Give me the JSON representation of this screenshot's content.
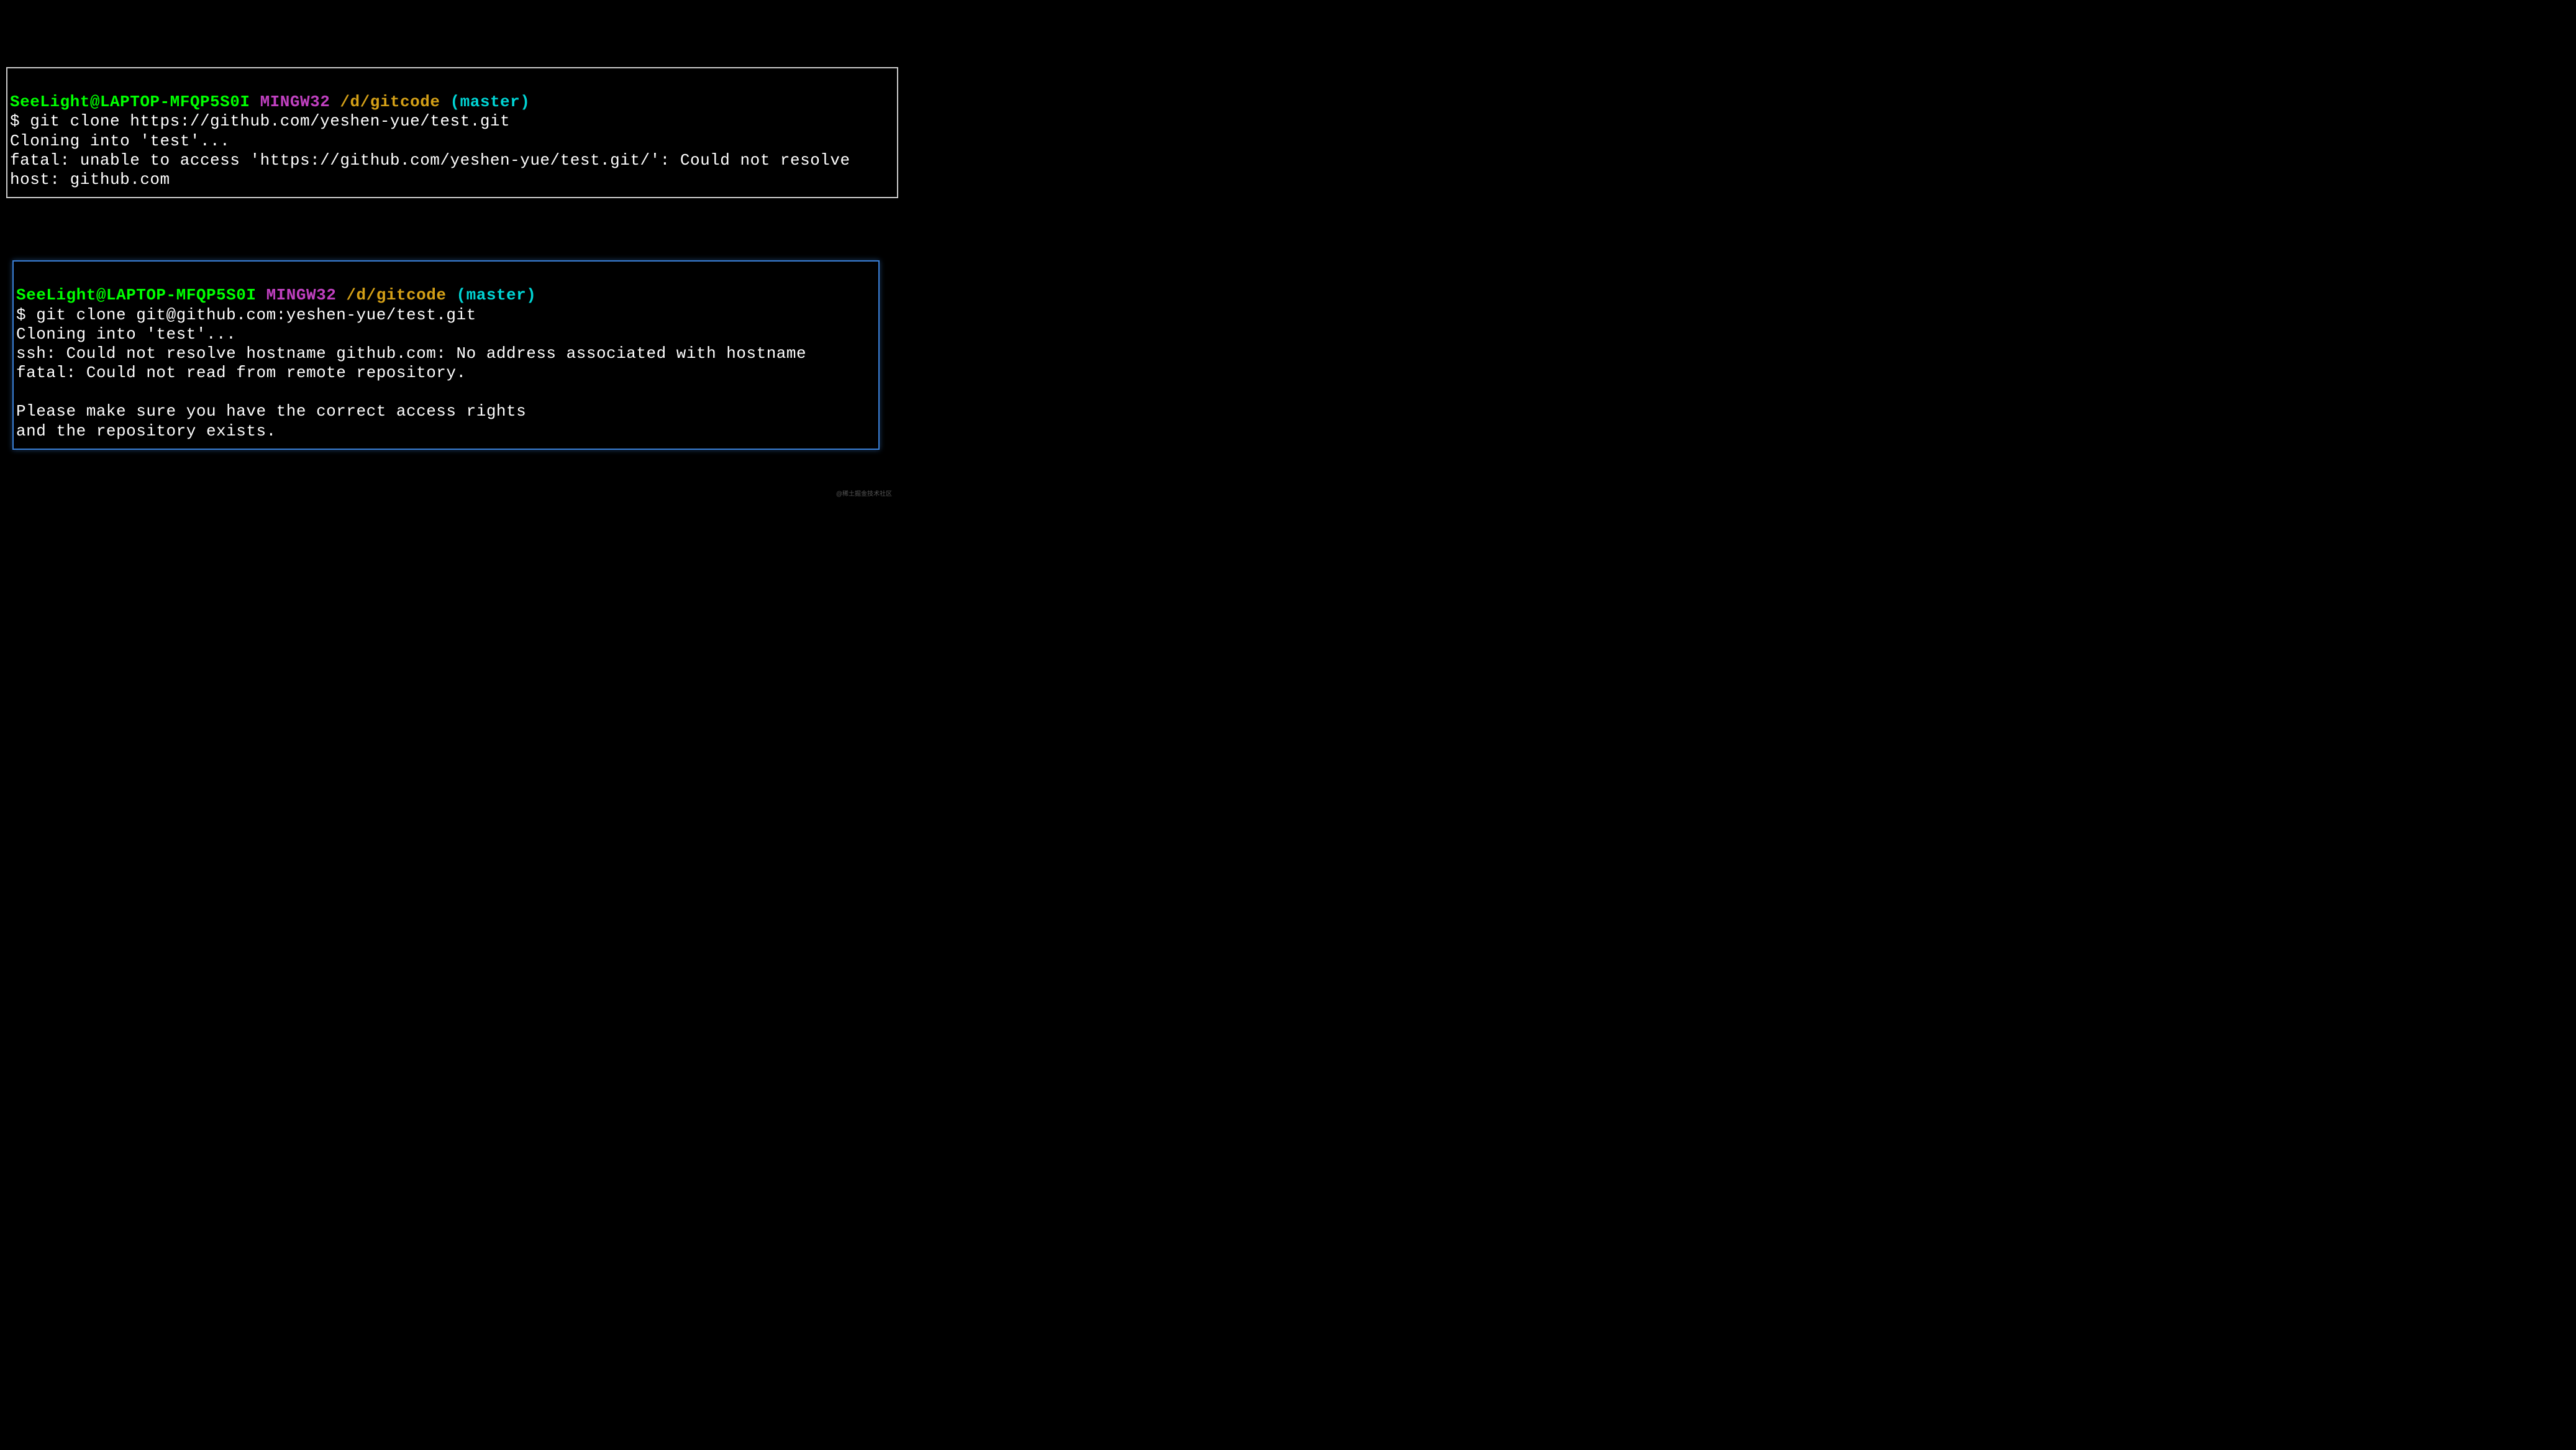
{
  "terminal1": {
    "prompt": {
      "userhost": "SeeLight@LAPTOP-MFQP5S0I",
      "env": "MINGW32",
      "path": "/d/gitcode",
      "branch": "(master)"
    },
    "command": "$ git clone https://github.com/yeshen-yue/test.git",
    "output1": "Cloning into 'test'...",
    "output2": "fatal: unable to access 'https://github.com/yeshen-yue/test.git/': Could not resolve host: github.com"
  },
  "terminal2": {
    "prompt": {
      "userhost": "SeeLight@LAPTOP-MFQP5S0I",
      "env": "MINGW32",
      "path": "/d/gitcode",
      "branch": "(master)"
    },
    "command": "$ git clone git@github.com:yeshen-yue/test.git",
    "output1": "Cloning into 'test'...",
    "output2": "ssh: Could not resolve hostname github.com: No address associated with hostname",
    "output3": "fatal: Could not read from remote repository.",
    "output4": "",
    "output5": "Please make sure you have the correct access rights",
    "output6": "and the repository exists."
  },
  "watermark": "@稀土掘金技术社区"
}
